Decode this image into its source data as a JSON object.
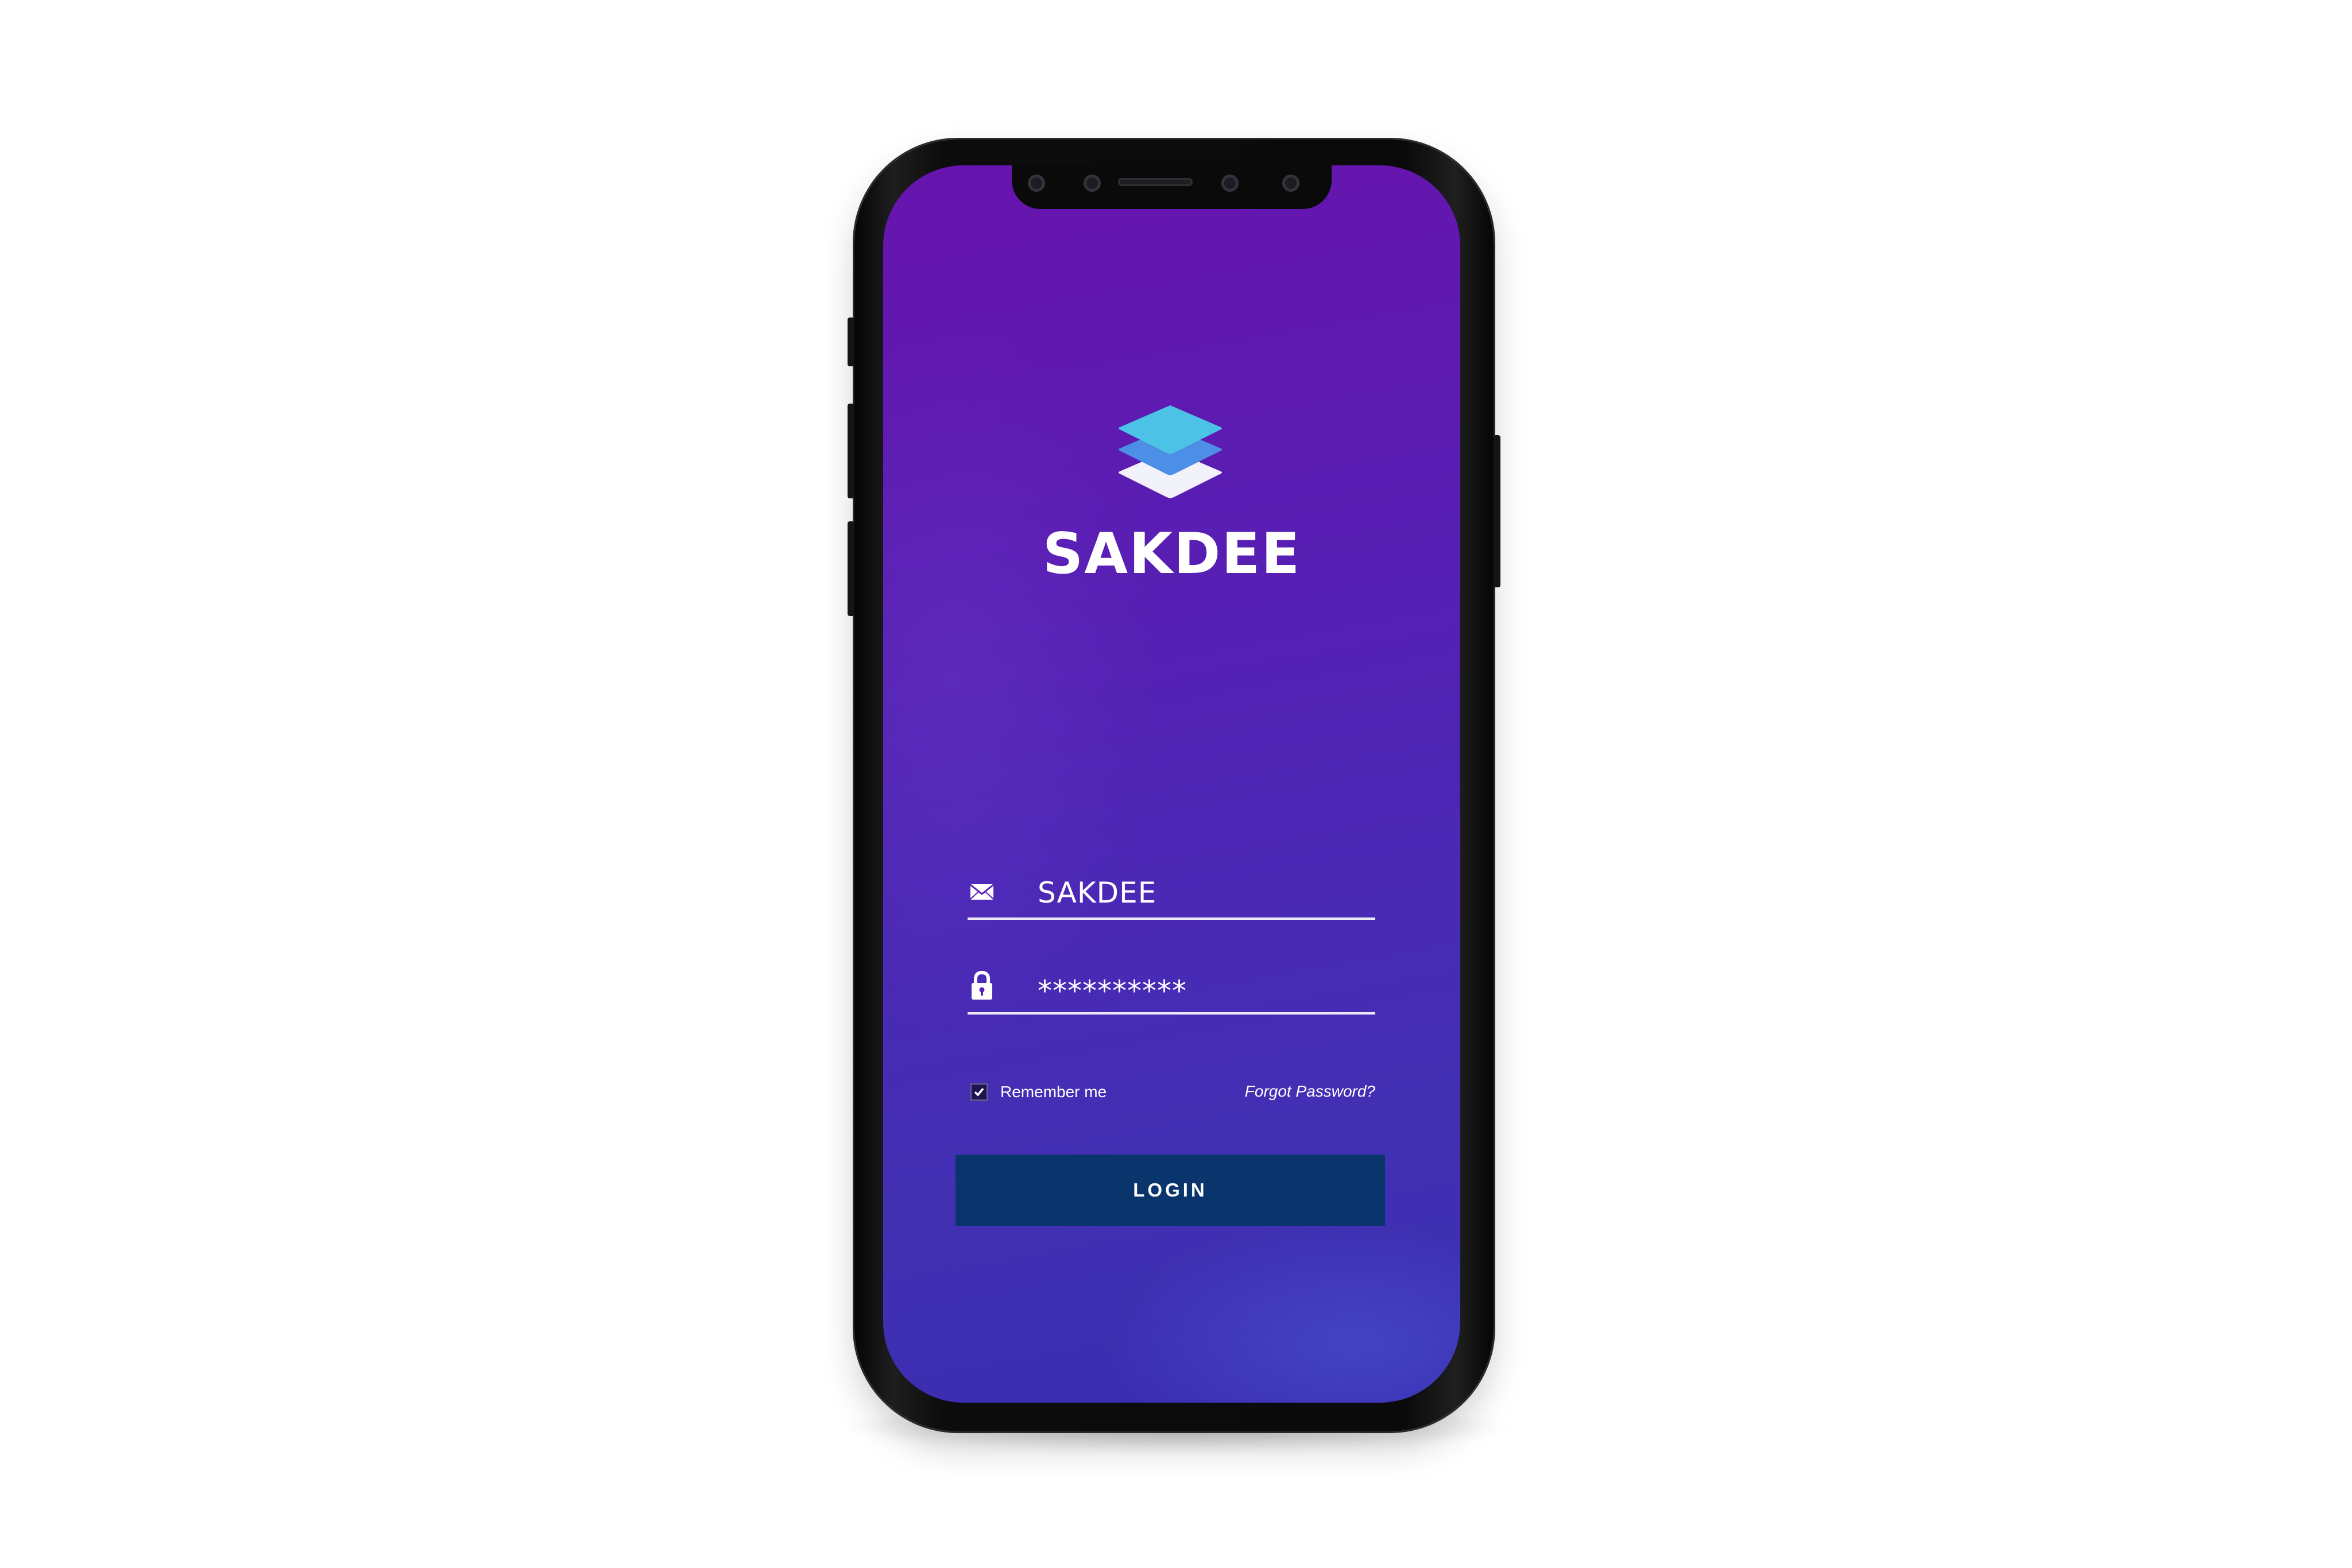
{
  "app": {
    "brand_name": "SAKDEE"
  },
  "login_form": {
    "username_value": "SAKDEE",
    "username_icon": "envelope-icon",
    "password_value": "**********",
    "password_icon": "lock-icon",
    "remember_label": "Remember me",
    "remember_checked": true,
    "forgot_label": "Forgot Password?",
    "login_label": "LOGIN"
  },
  "colors": {
    "background_top": "#6714ad",
    "background_bottom": "#3a2db0",
    "button": "#0a356c",
    "logo_top_layer": "#4cc3e6",
    "logo_middle_layer": "#4d8fe6",
    "logo_bottom_layer": "#f2f2fa"
  }
}
